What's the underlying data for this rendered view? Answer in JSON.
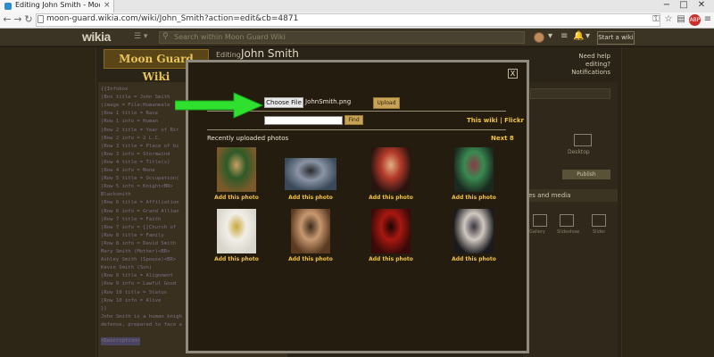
{
  "browser": {
    "tab_title": "Editing John Smith - Moon",
    "tab_close": "×",
    "url": "moon-guard.wikia.com/wiki/John_Smith?action=edit&cb=4871",
    "minimize": "−",
    "maximize": "□",
    "close": "✕"
  },
  "wikia": {
    "logo": "wikia",
    "search_placeholder": "Search within Moon Guard Wiki",
    "start_wiki": "Start a wiki"
  },
  "page": {
    "wiki_logo": "Moon Guard Wiki",
    "editing_label": "Editing",
    "title": "John Smith",
    "help_line1": "Need help editing?",
    "help_line2": "Notifications",
    "editor_lines": [
      "{{Infobox",
      "|Box title = John Smith",
      "|image = File:Humanmale",
      "|Row 1 title = Race",
      "|Row 1 info = Human",
      "|Row 2 title = Year of Bir",
      "|Row 2 info = 2 L.C.",
      "|Row 3 title = Place of bi",
      "|Row 3 info = Stormwind",
      "|Row 4 title = Title(s)",
      "|Row 4 info = None",
      "|Row 5 title = Occupation(",
      "|Row 5 info = Knight<BR>",
      "Blacksmith",
      "|Row 6 title = Affiliation",
      "|Row 6 info = Grand Allian",
      "|Row 7 title = Faith",
      "|Row 7 info = [[Church of",
      "|Row 8 title = Family",
      "|Row 8 info = David Smith",
      "Mary Smith (Mother)<BR>",
      "Ashley Smith (Spouse)<BR>",
      "Kevin Smith (Son)",
      "|Row 9 title = Alignment",
      "|Row 9 info = Lawful Good",
      "|Row 10 title = Status",
      "|Row 10 info = Alive",
      "}}",
      "John Smith is a human knigh",
      "defense, prepared to face a",
      "",
      "<Description>"
    ],
    "right_panel": {
      "mode": "Desktop",
      "publish": "Publish",
      "section_media": "es and media",
      "media_labels": [
        "Gallery",
        "Slideshow",
        "Slider"
      ]
    }
  },
  "modal": {
    "close": "X",
    "choose_file": "Choose File",
    "file_name": "JohnSmith.png",
    "upload": "Upload",
    "find": "Find",
    "source_links": "This wiki | Flickr",
    "recent_title": "Recently uploaded photos",
    "next": "Next 8",
    "add_label": "Add this photo",
    "photos": [
      {
        "name": "knight-portrait",
        "colors": [
          "#7a5a2a",
          "#2e5a28",
          "#c8a060"
        ]
      },
      {
        "name": "landscape-shore",
        "colors": [
          "#3a4a5a",
          "#8a94a4",
          "#2a2a30"
        ]
      },
      {
        "name": "redhead-woman",
        "colors": [
          "#2a1410",
          "#b43a2a",
          "#e0b080"
        ]
      },
      {
        "name": "green-creature",
        "colors": [
          "#1a2a20",
          "#3a8a50",
          "#8a3a4a"
        ]
      },
      {
        "name": "banner-sun",
        "colors": [
          "#d8d6cc",
          "#f0eee6",
          "#c8a83a"
        ]
      },
      {
        "name": "woman-portrait",
        "colors": [
          "#5a3a20",
          "#c89870",
          "#3a2a1a"
        ]
      },
      {
        "name": "red-demon",
        "colors": [
          "#3a0a08",
          "#a81810",
          "#1a0504"
        ]
      },
      {
        "name": "dark-figure",
        "colors": [
          "#1a1a1e",
          "#d0c8c0",
          "#3a3440"
        ]
      }
    ]
  }
}
